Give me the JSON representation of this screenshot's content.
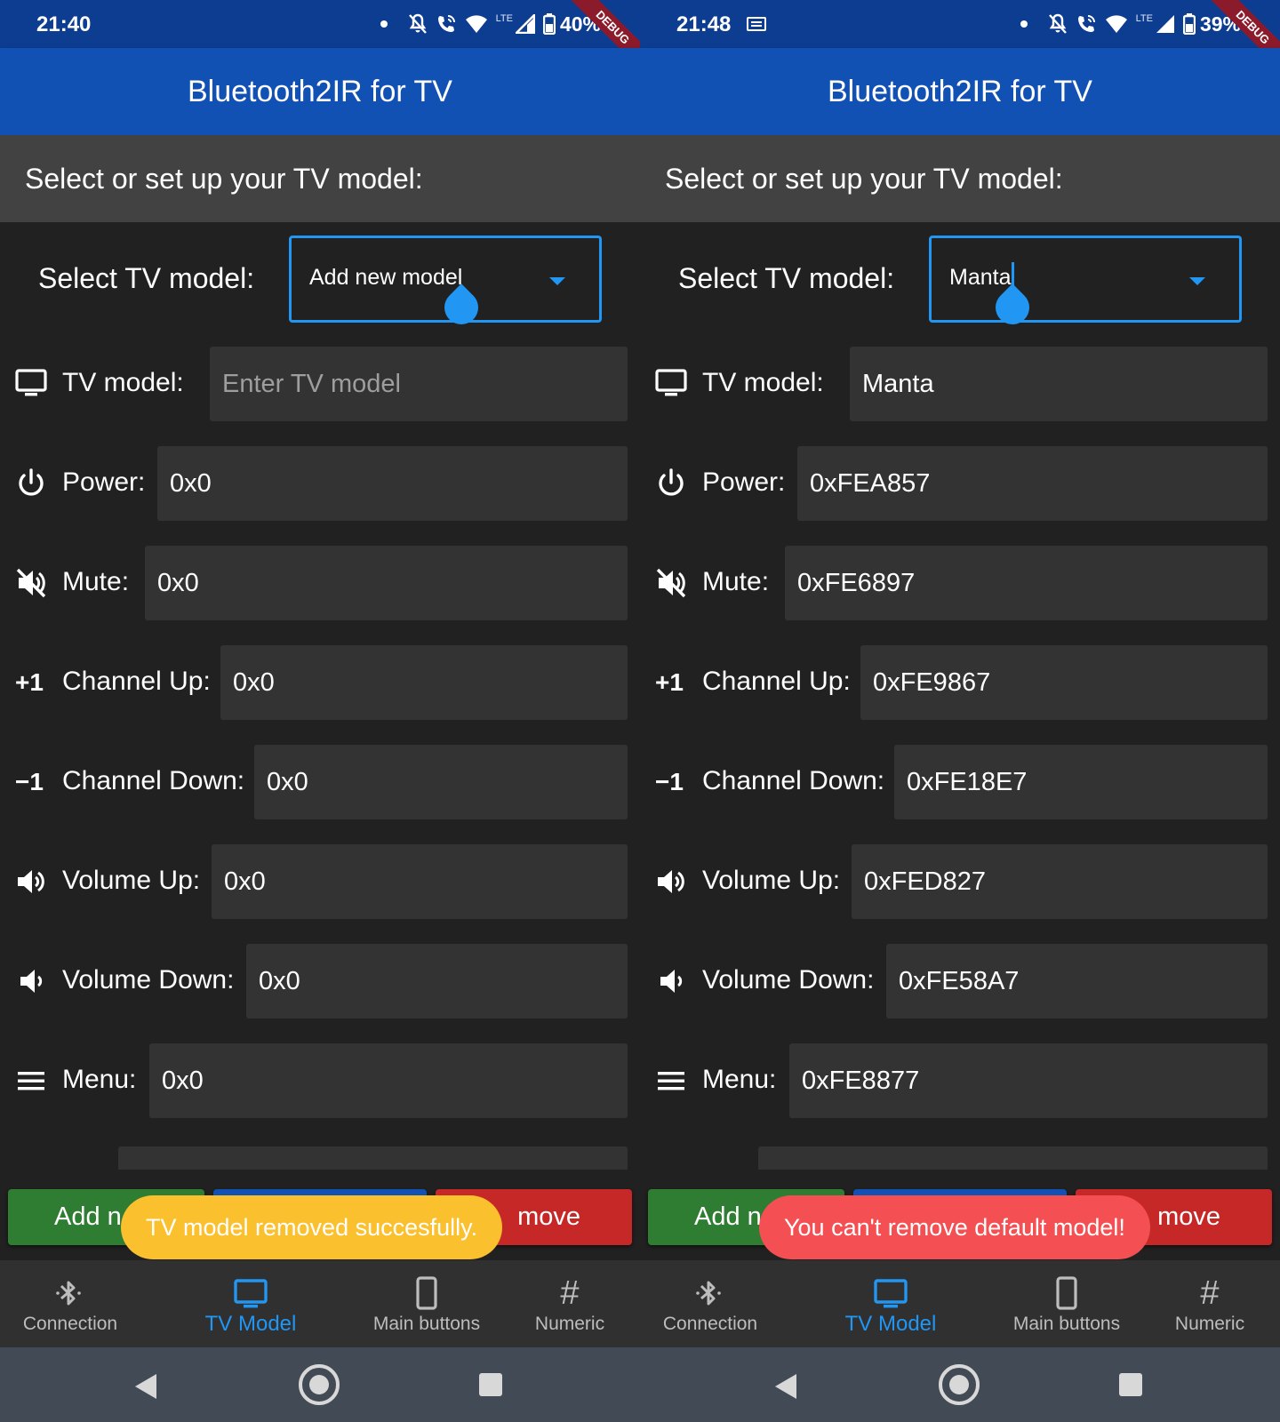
{
  "app_title": "Bluetooth2IR for TV",
  "section_title": "Select or set up your TV model:",
  "select_label": "Select TV model:",
  "tv_model_label": "TV model:",
  "fields": {
    "power": "Power:",
    "mute": "Mute:",
    "channel_up": "Channel Up:",
    "channel_down": "Channel Down:",
    "volume_up": "Volume Up:",
    "volume_down": "Volume Down:",
    "menu": "Menu:"
  },
  "icon_text": {
    "plus_one": "+1",
    "minus_one": "−1",
    "hash": "#"
  },
  "buttons": {
    "add": "Add n",
    "remove": "move"
  },
  "nav": {
    "connection": "Connection",
    "tv_model": "TV Model",
    "main_buttons": "Main buttons",
    "numeric": "Numeric"
  },
  "debug_banner": "DEBUG",
  "colors": {
    "appbar": "#1151b3",
    "accent": "#2196f3",
    "add": "#2e7d32",
    "remove": "#c62828",
    "toast_success": "#fbc02d",
    "toast_error": "#f44f52"
  },
  "left": {
    "time": "21:40",
    "battery": "40%",
    "lte": "LTE",
    "select_value": "Add new model",
    "tv_model_value": "",
    "tv_model_placeholder": "Enter TV model",
    "values": {
      "power": "0x0",
      "mute": "0x0",
      "channel_up": "0x0",
      "channel_down": "0x0",
      "volume_up": "0x0",
      "volume_down": "0x0",
      "menu": "0x0"
    },
    "toast": "TV model removed succesfully."
  },
  "right": {
    "time": "21:48",
    "battery": "39%",
    "lte": "LTE",
    "select_value": "Manta",
    "tv_model_value": "Manta",
    "values": {
      "power": "0xFEA857",
      "mute": "0xFE6897",
      "channel_up": "0xFE9867",
      "channel_down": "0xFE18E7",
      "volume_up": "0xFED827",
      "volume_down": "0xFE58A7",
      "menu": "0xFE8877"
    },
    "toast": "You can't remove default model!"
  }
}
